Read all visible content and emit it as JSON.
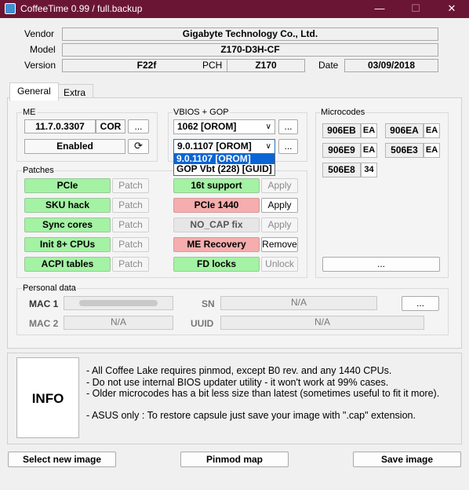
{
  "window": {
    "title": "CoffeeTime 0.99  /  full.backup",
    "minimize": "—",
    "maximize": "☐",
    "close": "✕"
  },
  "header": {
    "vendor_label": "Vendor",
    "vendor": "Gigabyte Technology Co., Ltd.",
    "model_label": "Model",
    "model": "Z170-D3H-CF",
    "version_label": "Version",
    "version": "F22f",
    "pch_label": "PCH",
    "pch": "Z170",
    "date_label": "Date",
    "date": "03/09/2018"
  },
  "tabs": [
    {
      "label": "General"
    },
    {
      "label": "Extra"
    }
  ],
  "me": {
    "label": "ME",
    "version": "11.7.0.3307",
    "type": "COR",
    "more": "...",
    "state": "Enabled",
    "refresh_icon": "refresh-icon"
  },
  "vbios": {
    "label": "VBIOS + GOP",
    "vbios_value": "1062 [OROM]",
    "gop_value": "9.0.1107 [OROM]",
    "more1": "...",
    "more2": "...",
    "dropdown_options": [
      "9.0.1107 [OROM]",
      "GOP Vbt (228) [GUID]"
    ]
  },
  "microcodes": {
    "label": "Microcodes",
    "items": [
      {
        "id": "906EB",
        "tag": "EA"
      },
      {
        "id": "906EA",
        "tag": "EA"
      },
      {
        "id": "906E9",
        "tag": "EA"
      },
      {
        "id": "506E3",
        "tag": "EA"
      },
      {
        "id": "506E8",
        "tag": "34"
      }
    ],
    "more": "..."
  },
  "patches": {
    "label": "Patches",
    "left": [
      {
        "name": "PCIe",
        "action": "Patch"
      },
      {
        "name": "SKU hack",
        "action": "Patch"
      },
      {
        "name": "Sync cores",
        "action": "Patch"
      },
      {
        "name": "Init 8+ CPUs",
        "action": "Patch"
      },
      {
        "name": "ACPI tables",
        "action": "Patch"
      }
    ],
    "right": [
      {
        "name": "16t support",
        "action": "Apply"
      },
      {
        "name": "PCIe 1440",
        "action": "Apply"
      },
      {
        "name": "NO_CAP fix",
        "action": "Apply"
      },
      {
        "name": "ME Recovery",
        "action": "Remove"
      },
      {
        "name": "FD locks",
        "action": "Unlock"
      }
    ]
  },
  "personal": {
    "label": "Personal data",
    "mac1_label": "MAC 1",
    "mac1": "",
    "mac2_label": "MAC 2",
    "mac2": "N/A",
    "sn_label": "SN",
    "sn": "N/A",
    "uuid_label": "UUID",
    "uuid": "N/A",
    "more": "..."
  },
  "info": {
    "title": "INFO",
    "lines": [
      "- All Coffee Lake requires pinmod, except B0 rev. and any 1440 CPUs.",
      "- Do not use internal BIOS updater utility - it won't work at 99% cases.",
      "- Older microcodes has a bit less size than latest (sometimes useful to fit it more).",
      "- ASUS only : To restore capsule just save your image with \".cap\" extension."
    ]
  },
  "buttons": {
    "select": "Select new image",
    "pinmod": "Pinmod map",
    "save": "Save image"
  },
  "colors": {
    "titlebar": "#6b1534",
    "green": "#a4f2a4",
    "red": "#f5adad",
    "selection": "#0a64d6"
  }
}
